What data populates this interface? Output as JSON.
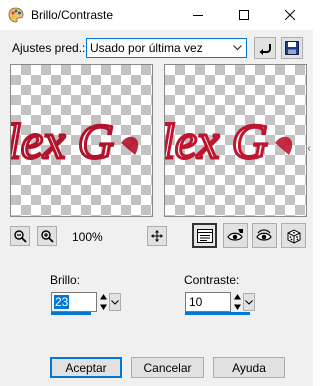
{
  "window": {
    "title": "Brillo/Contraste"
  },
  "presets": {
    "label": "Ajustes pred.:",
    "selected": "Usado por última vez"
  },
  "preview": {
    "sample_text": "lex G"
  },
  "zoom": {
    "value": "100%"
  },
  "brightness": {
    "label": "Brillo:",
    "value": "23"
  },
  "contrast": {
    "label": "Contraste:",
    "value": "10"
  },
  "buttons": {
    "ok": "Aceptar",
    "cancel": "Cancelar",
    "help": "Ayuda"
  },
  "colors": {
    "accent": "#0078d7",
    "text_red": "#b3122b",
    "checker": "#c3c3c3"
  },
  "icons": {
    "title": "paint-palette-icon",
    "reset": "reset-arrow-icon",
    "save": "save-disk-icon",
    "zoom_out": "zoom-out-icon",
    "zoom_in": "zoom-in-icon",
    "pan": "pan-move-icon",
    "toggle_preview": "preview-toggle-icon",
    "proof": "proof-eye-icon",
    "auto_proof": "auto-proof-eye-icon",
    "random": "randomize-dice-icon"
  }
}
